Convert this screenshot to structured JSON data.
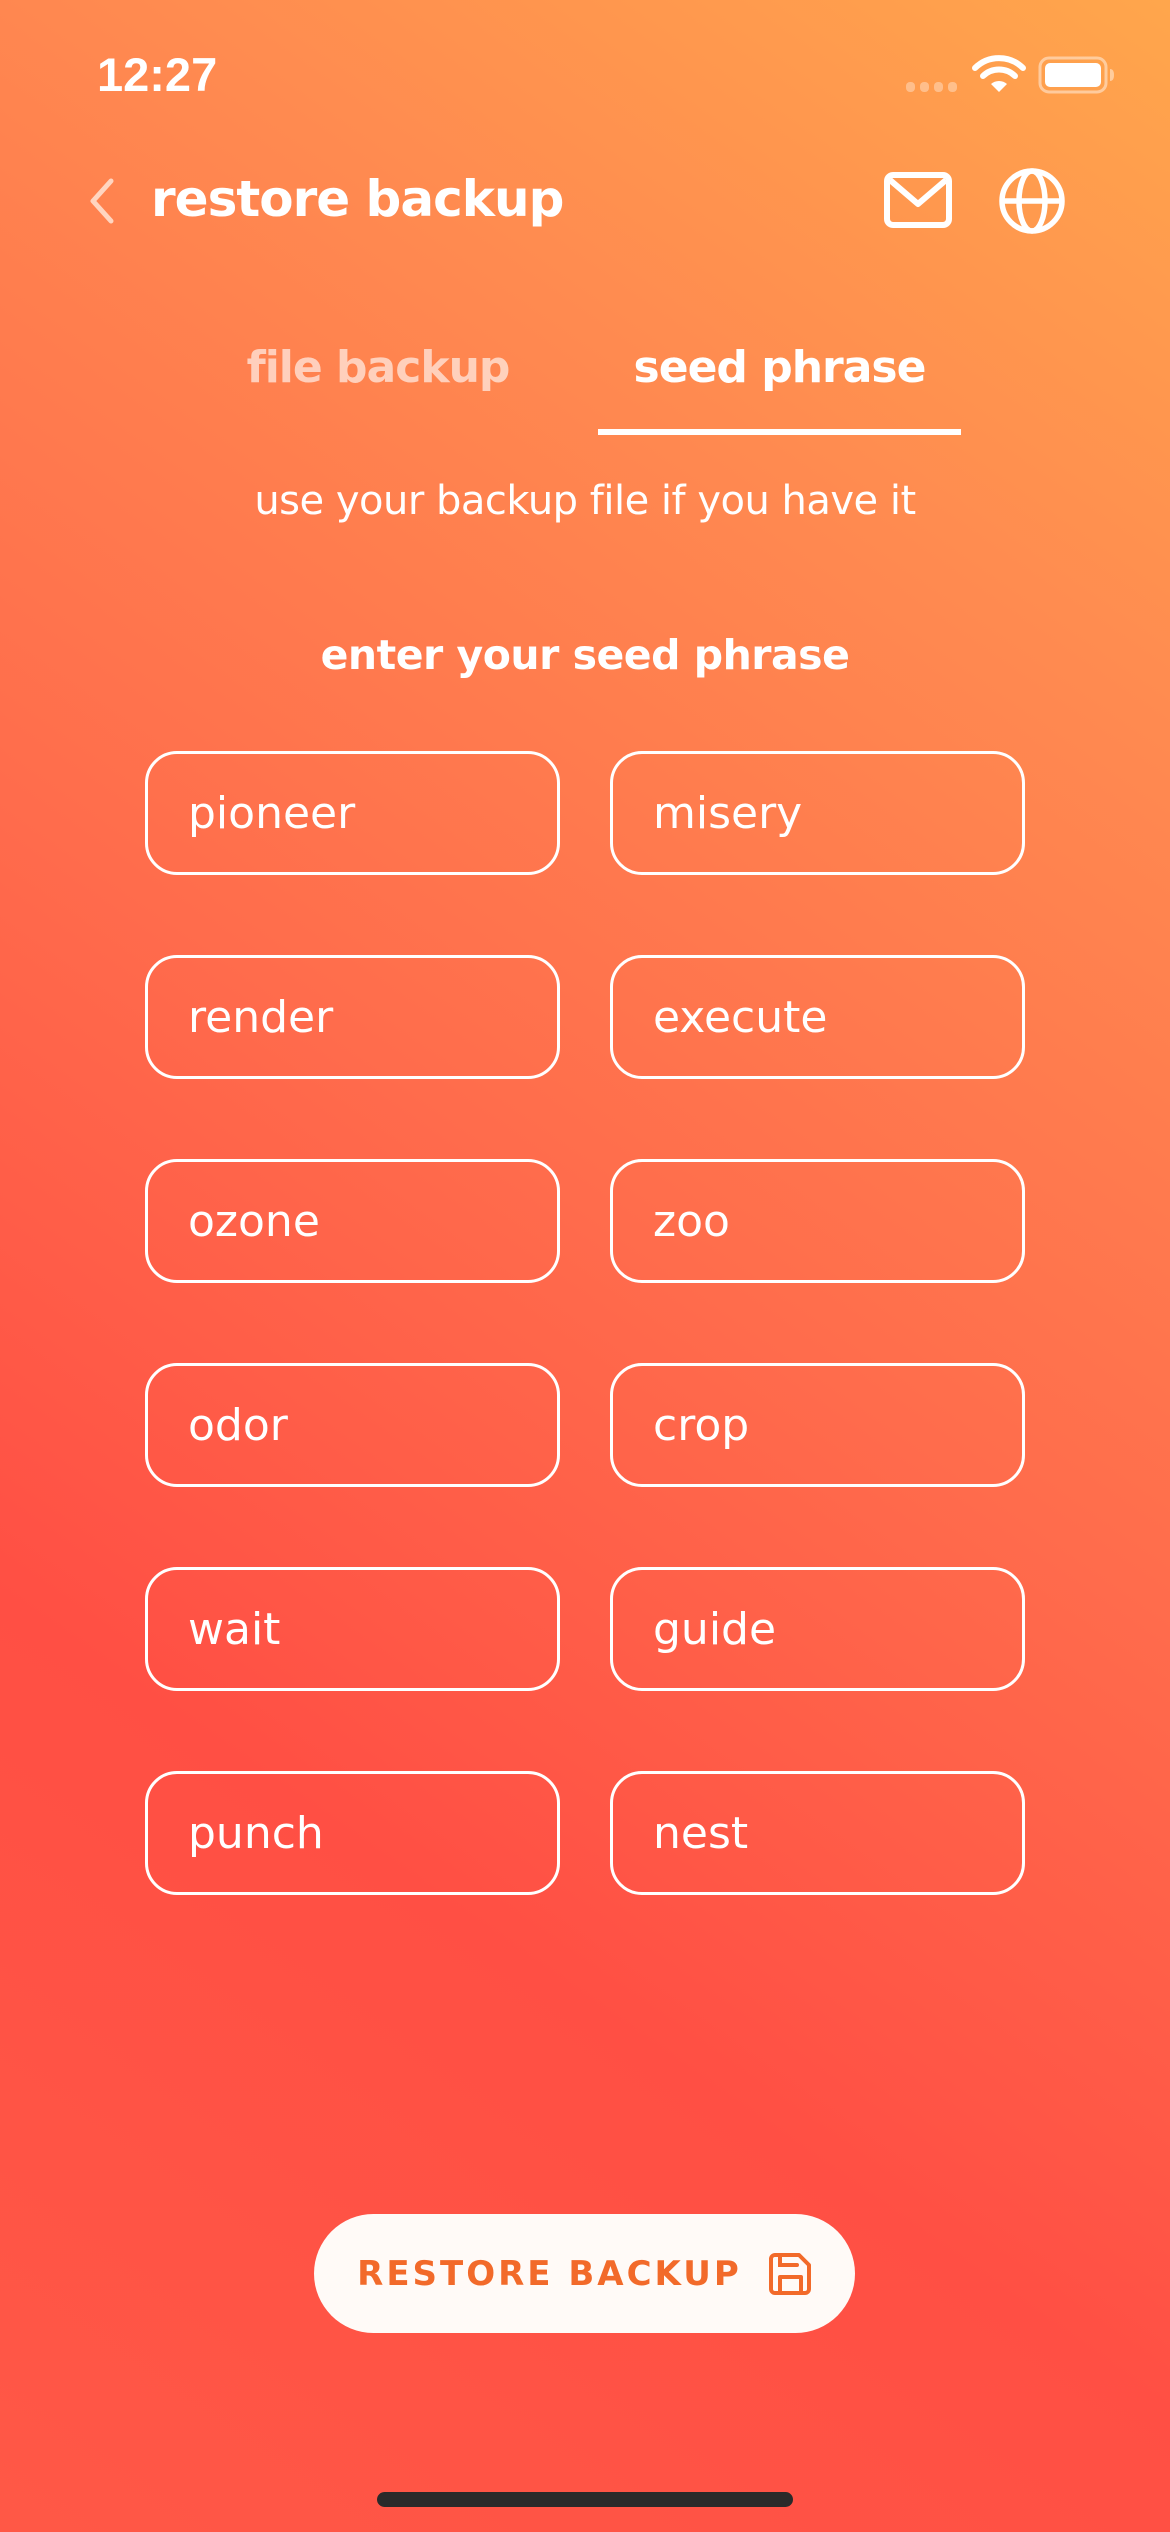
{
  "status_bar": {
    "time": "12:27",
    "icons": [
      "signal-dots-icon",
      "wifi-icon",
      "battery-icon"
    ]
  },
  "header": {
    "back_icon": "chevron-left-icon",
    "title": "restore backup",
    "actions": [
      {
        "name": "mail",
        "icon": "mail-icon"
      },
      {
        "name": "language",
        "icon": "globe-icon"
      }
    ]
  },
  "tabs": [
    {
      "label": "file backup",
      "active": false
    },
    {
      "label": "seed phrase",
      "active": true
    }
  ],
  "subtitle": "use your backup file if you have it",
  "seed_section": {
    "heading": "enter your seed phrase",
    "words": [
      "pioneer",
      "misery",
      "render",
      "execute",
      "ozone",
      "zoo",
      "odor",
      "crop",
      "wait",
      "guide",
      "punch",
      "nest"
    ]
  },
  "restore_button": {
    "label": "RESTORE BACKUP",
    "icon": "floppy-disk-icon"
  },
  "colors": {
    "gradient_top_right": "#ffa64c",
    "gradient_bottom_left": "#ff4f44",
    "button_background": "#fffaf7",
    "button_text": "#f26a2a",
    "home_indicator": "#2a2a2a"
  }
}
